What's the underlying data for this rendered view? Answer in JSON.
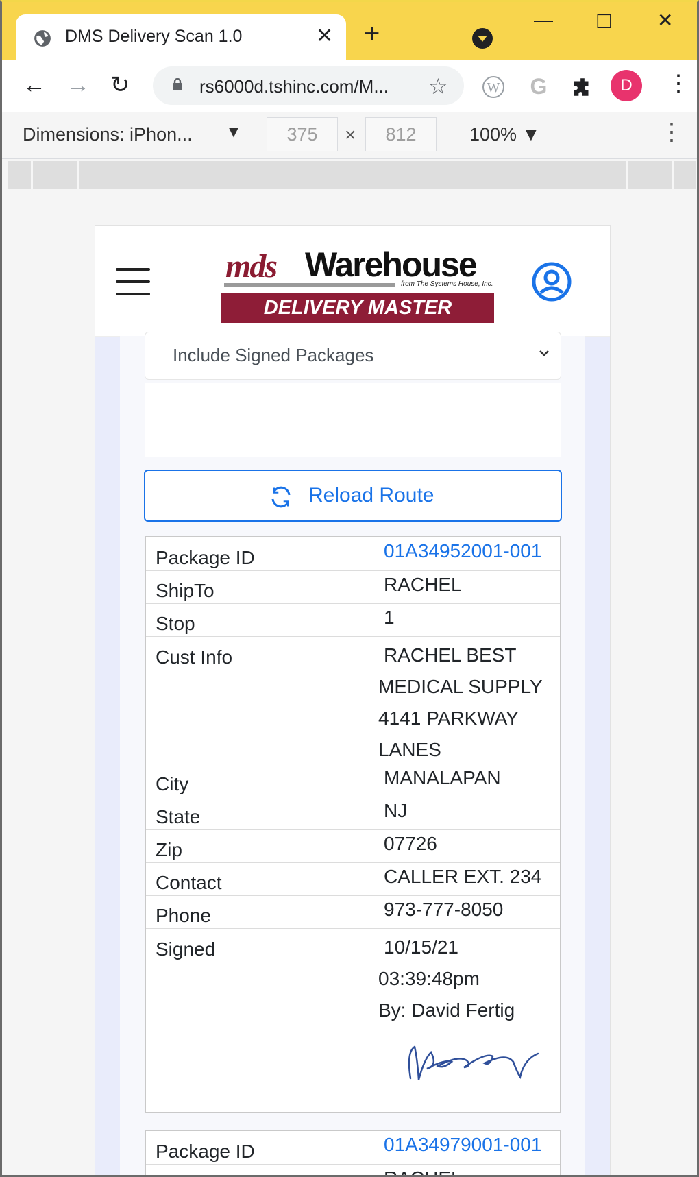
{
  "browser": {
    "tab_title": "DMS Delivery Scan 1.0",
    "url": "rs6000d.tshinc.com/M...",
    "profile_initial": "D"
  },
  "devtools": {
    "dimensions_label": "Dimensions: iPhon...",
    "width": "375",
    "height": "812",
    "times": "×",
    "zoom": "100% ▼",
    "dropdown_arrow": "▼"
  },
  "app": {
    "logo_mds": "mds",
    "logo_warehouse": "Warehouse",
    "logo_from": "from The Systems House, Inc.",
    "logo_banner": "DELIVERY MASTER",
    "filter_select": "Include Signed Packages",
    "reload_label": "Reload Route"
  },
  "packages": [
    {
      "labels": {
        "package_id": "Package ID",
        "ship_to": "ShipTo",
        "stop": "Stop",
        "cust_info": "Cust Info",
        "city": "City",
        "state": "State",
        "zip": "Zip",
        "contact": "Contact",
        "phone": "Phone",
        "signed": "Signed"
      },
      "package_id": "01A34952001-001",
      "ship_to": "RACHEL",
      "stop": "1",
      "cust_info": [
        "RACHEL BEST",
        "MEDICAL SUPPLY",
        "4141 PARKWAY",
        "LANES"
      ],
      "city": "MANALAPAN",
      "state": "NJ",
      "zip": "07726",
      "contact": "CALLER EXT. 234",
      "phone": "973-777-8050",
      "signed": [
        "10/15/21",
        "03:39:48pm",
        "By: David Fertig"
      ]
    },
    {
      "labels": {
        "package_id": "Package ID"
      },
      "package_id": "01A34979001-001",
      "ship_to": "RACHEL"
    }
  ],
  "colors": {
    "tab_strip": "#f8d54d",
    "accent_blue": "#1a73e8",
    "brand_maroon": "#8e1d37",
    "profile_pink": "#e8336d"
  }
}
